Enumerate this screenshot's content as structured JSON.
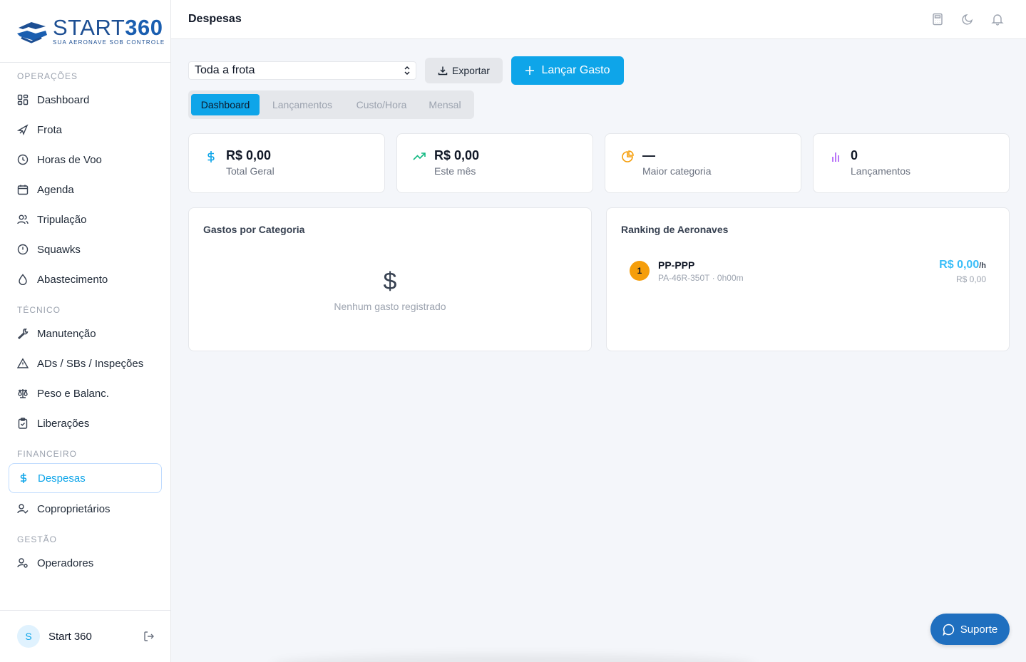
{
  "brand": {
    "word_a": "START",
    "word_b": "360",
    "tagline": "SUA AERONAVE SOB CONTROLE"
  },
  "nav": {
    "sections": [
      "OPERAÇÕES",
      "TÉCNICO",
      "FINANCEIRO",
      "GESTÃO"
    ],
    "items": [
      {
        "label": "Dashboard",
        "icon": "grid-icon"
      },
      {
        "label": "Frota",
        "icon": "plane-icon"
      },
      {
        "label": "Horas de Voo",
        "icon": "clock-icon"
      },
      {
        "label": "Agenda",
        "icon": "calendar-icon"
      },
      {
        "label": "Tripulação",
        "icon": "users-icon"
      },
      {
        "label": "Squawks",
        "icon": "alert-circle-icon"
      },
      {
        "label": "Abastecimento",
        "icon": "fuel-drop-icon"
      },
      {
        "label": "Manutenção",
        "icon": "wrench-icon"
      },
      {
        "label": "ADs / SBs / Inspeções",
        "icon": "warning-triangle-icon"
      },
      {
        "label": "Peso e Balanc.",
        "icon": "scale-icon"
      },
      {
        "label": "Liberações",
        "icon": "clipboard-check-icon"
      },
      {
        "label": "Despesas",
        "icon": "dollar-icon",
        "active": true
      },
      {
        "label": "Coproprietários",
        "icon": "user-check-icon"
      },
      {
        "label": "Operadores",
        "icon": "user-cog-icon"
      }
    ]
  },
  "user": {
    "initial": "S",
    "name": "Start 360"
  },
  "header": {
    "title": "Despesas"
  },
  "toolbar": {
    "fleet_select": "Toda a frota",
    "export_label": "Exportar",
    "add_label": "Lançar Gasto"
  },
  "tabs": [
    "Dashboard",
    "Lançamentos",
    "Custo/Hora",
    "Mensal"
  ],
  "stats": [
    {
      "value": "R$ 0,00",
      "label": "Total Geral",
      "color": "#0ea5e9"
    },
    {
      "value": "R$ 0,00",
      "label": "Este mês",
      "color": "#10b981"
    },
    {
      "value": "—",
      "label": "Maior categoria",
      "color": "#f59e0b"
    },
    {
      "value": "0",
      "label": "Lançamentos",
      "color": "#a855f7"
    }
  ],
  "category_panel": {
    "title": "Gastos por Categoria",
    "empty_icon": "$",
    "empty_text": "Nenhum gasto registrado"
  },
  "ranking_panel": {
    "title": "Ranking de Aeronaves",
    "items": [
      {
        "rank": "1",
        "name": "PP-PPP",
        "detail": "PA-46R-350T · 0h00m",
        "value": "R$ 0,00",
        "unit": "/h",
        "total": "R$ 0,00"
      }
    ]
  },
  "support": {
    "label": "Suporte"
  }
}
